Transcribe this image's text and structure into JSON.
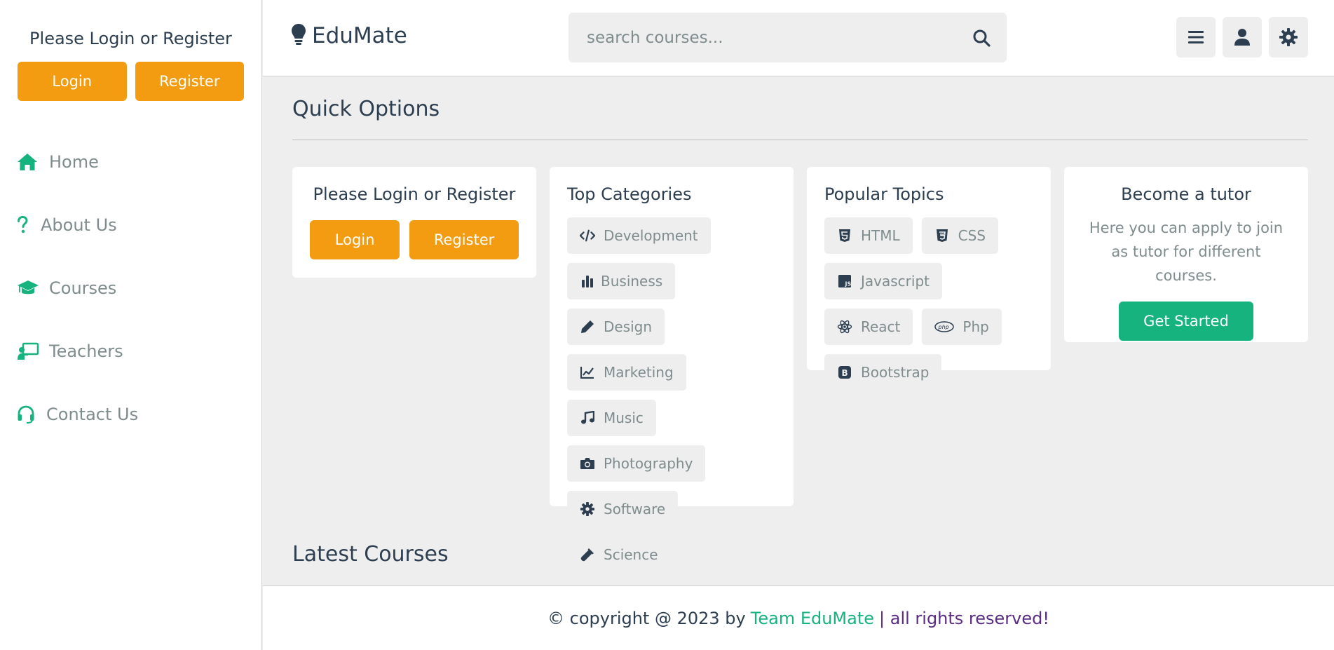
{
  "colors": {
    "accent_orange": "#f39c12",
    "accent_green": "#16b37f",
    "text_dark": "#2c3e50",
    "text_muted": "#7f8c8d",
    "footer_rights": "#5b2c83",
    "background": "#eeeeee"
  },
  "sidebar": {
    "title": "Please Login or Register",
    "login_label": "Login",
    "register_label": "Register",
    "nav": [
      {
        "label": "Home",
        "icon": "home-icon"
      },
      {
        "label": "About Us",
        "icon": "question-icon"
      },
      {
        "label": "Courses",
        "icon": "graduation-cap-icon"
      },
      {
        "label": "Teachers",
        "icon": "chalkboard-teacher-icon"
      },
      {
        "label": "Contact Us",
        "icon": "headset-icon"
      }
    ]
  },
  "header": {
    "logo_icon": "lightbulb-icon",
    "logo_text": "EduMate",
    "search_placeholder": "search courses...",
    "icons": [
      "menu-icon",
      "user-icon",
      "gear-icon"
    ]
  },
  "main": {
    "quick_options_title": "Quick Options",
    "login_card": {
      "title": "Please Login or Register",
      "login_label": "Login",
      "register_label": "Register"
    },
    "categories_card": {
      "title": "Top Categories",
      "tags": [
        {
          "label": "Development",
          "icon": "code-icon"
        },
        {
          "label": "Business",
          "icon": "chart-bar-icon"
        },
        {
          "label": "Design",
          "icon": "pen-icon"
        },
        {
          "label": "Marketing",
          "icon": "chart-line-icon"
        },
        {
          "label": "Music",
          "icon": "music-icon"
        },
        {
          "label": "Photography",
          "icon": "camera-icon"
        },
        {
          "label": "Software",
          "icon": "cog-icon"
        },
        {
          "label": "Science",
          "icon": "vial-icon"
        }
      ]
    },
    "topics_card": {
      "title": "Popular Topics",
      "tags": [
        {
          "label": "HTML",
          "icon": "html5-icon"
        },
        {
          "label": "CSS",
          "icon": "css3-icon"
        },
        {
          "label": "Javascript",
          "icon": "js-icon"
        },
        {
          "label": "React",
          "icon": "react-icon"
        },
        {
          "label": "Php",
          "icon": "php-icon"
        },
        {
          "label": "Bootstrap",
          "icon": "bootstrap-icon"
        }
      ]
    },
    "tutor_card": {
      "title": "Become a tutor",
      "text": "Here you can apply to join as tutor for different courses.",
      "button_label": "Get Started"
    },
    "latest_courses_title": "Latest Courses"
  },
  "footer": {
    "prefix": "© copyright @ 2023 by",
    "team": "Team EduMate",
    "suffix": "| all rights reserved!"
  }
}
